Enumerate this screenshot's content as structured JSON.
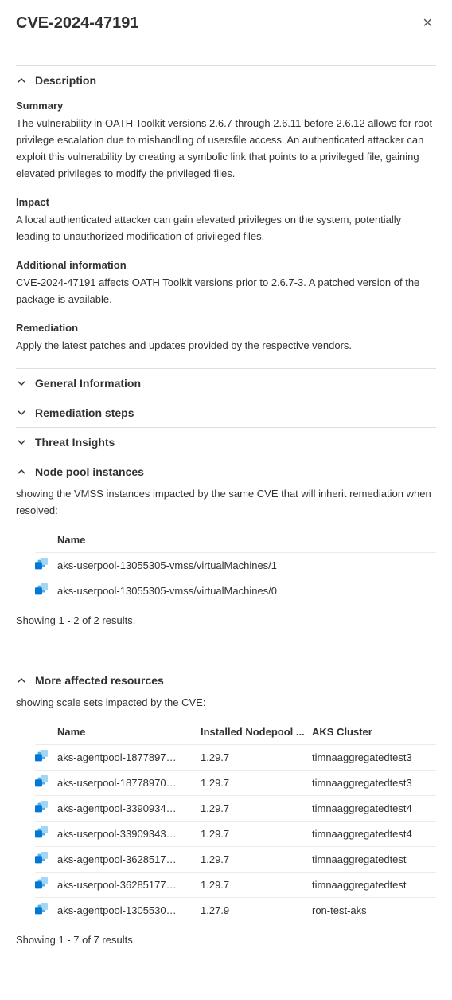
{
  "title": "CVE-2024-47191",
  "sections": {
    "description": {
      "title": "Description",
      "summary_label": "Summary",
      "summary_text": "The vulnerability in OATH Toolkit versions 2.6.7 through 2.6.11 before 2.6.12 allows for root privilege escalation due to mishandling of usersfile access. An authenticated attacker can exploit this vulnerability by creating a symbolic link that points to a privileged file, gaining elevated privileges to modify the privileged files.",
      "impact_label": "Impact",
      "impact_text": "A local authenticated attacker can gain elevated privileges on the system, potentially leading to unauthorized modification of privileged files.",
      "additional_label": "Additional information",
      "additional_text": "CVE-2024-47191 affects OATH Toolkit versions prior to 2.6.7-3. A patched version of the package is available.",
      "remediation_label": "Remediation",
      "remediation_text": "Apply the latest patches and updates provided by the respective vendors."
    },
    "general_info": {
      "title": "General Information"
    },
    "remediation_steps": {
      "title": "Remediation steps"
    },
    "threat_insights": {
      "title": "Threat Insights"
    },
    "node_pool": {
      "title": "Node pool instances",
      "intro": "showing the VMSS instances impacted by the same CVE that will inherit remediation when resolved:",
      "name_header": "Name",
      "rows": [
        {
          "name": "aks-userpool-13055305-vmss/virtualMachines/1"
        },
        {
          "name": "aks-userpool-13055305-vmss/virtualMachines/0"
        }
      ],
      "results": "Showing 1 - 2 of 2 results."
    },
    "more_affected": {
      "title": "More affected resources",
      "intro": "showing scale sets impacted by the CVE:",
      "name_header": "Name",
      "installed_header": "Installed Nodepool ...",
      "cluster_header": "AKS Cluster",
      "rows": [
        {
          "name": "aks-agentpool-1877897…",
          "installed": "1.29.7",
          "cluster": "timnaaggregatedtest3"
        },
        {
          "name": "aks-userpool-18778970…",
          "installed": "1.29.7",
          "cluster": "timnaaggregatedtest3"
        },
        {
          "name": "aks-agentpool-3390934…",
          "installed": "1.29.7",
          "cluster": "timnaaggregatedtest4"
        },
        {
          "name": "aks-userpool-33909343…",
          "installed": "1.29.7",
          "cluster": "timnaaggregatedtest4"
        },
        {
          "name": "aks-agentpool-3628517…",
          "installed": "1.29.7",
          "cluster": "timnaaggregatedtest"
        },
        {
          "name": "aks-userpool-36285177…",
          "installed": "1.29.7",
          "cluster": "timnaaggregatedtest"
        },
        {
          "name": "aks-agentpool-1305530…",
          "installed": "1.27.9",
          "cluster": "ron-test-aks"
        }
      ],
      "results": "Showing 1 - 7 of 7 results."
    }
  }
}
